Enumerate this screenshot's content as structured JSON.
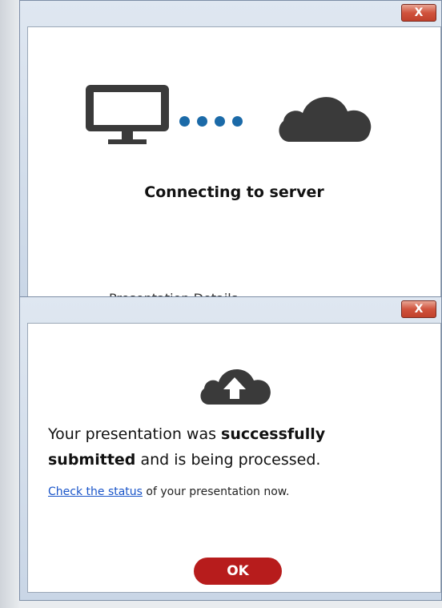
{
  "window1": {
    "close_label": "X",
    "monitor_icon": "desktop-monitor-icon",
    "cloud_icon": "cloud-icon",
    "status_text": "Connecting to server",
    "accent_color": "#1b6aa8"
  },
  "background": {
    "peek_heading": "Presentation Details"
  },
  "window2": {
    "close_label": "X",
    "cloud_icon": "cloud-upload-icon",
    "message": {
      "part1": "Your presentation was ",
      "bold1": "successfully",
      "newline_bold2": "submitted",
      "part2": " and is being processed."
    },
    "status_link": "Check the status",
    "status_suffix": " of your presentation now.",
    "ok_label": "OK",
    "ok_color": "#b71c1c"
  }
}
